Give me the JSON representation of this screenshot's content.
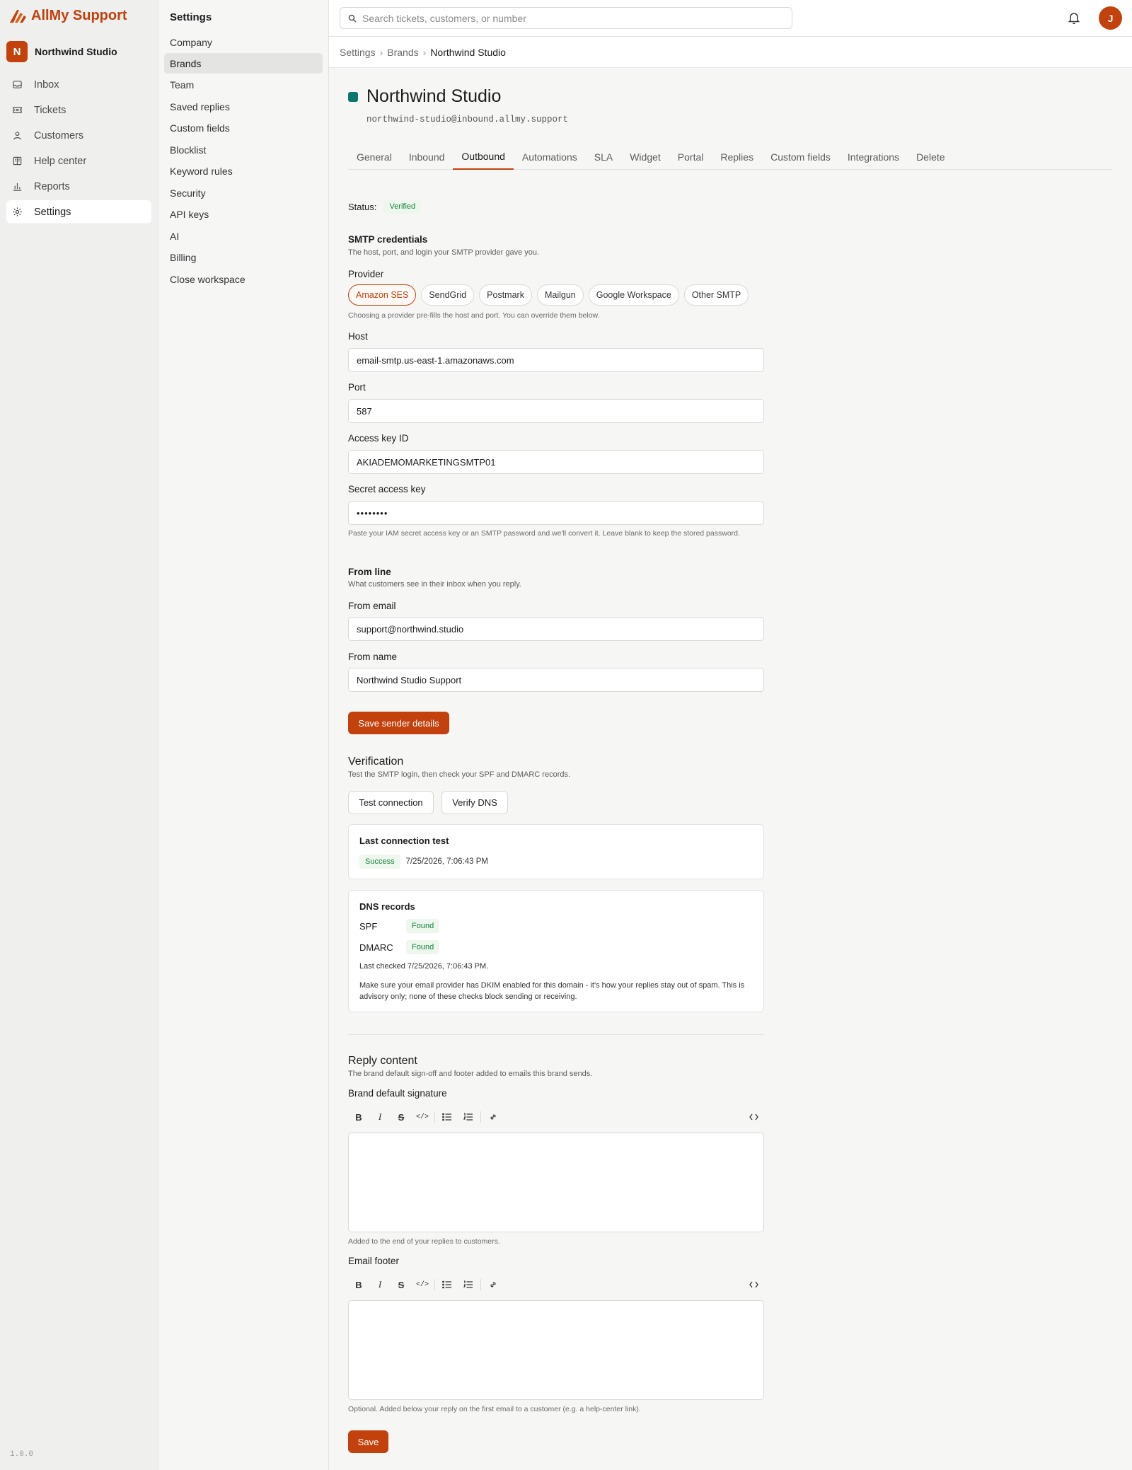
{
  "app": {
    "name": "AllMy Support",
    "version": "1.0.0",
    "accent": "#c2410c"
  },
  "workspace": {
    "initial": "N",
    "name": "Northwind Studio"
  },
  "nav": [
    {
      "label": "Inbox",
      "icon": "inbox-icon"
    },
    {
      "label": "Tickets",
      "icon": "ticket-icon"
    },
    {
      "label": "Customers",
      "icon": "user-icon"
    },
    {
      "label": "Help center",
      "icon": "book-icon"
    },
    {
      "label": "Reports",
      "icon": "bar-chart-icon"
    },
    {
      "label": "Settings",
      "icon": "gear-icon",
      "active": true
    }
  ],
  "settings_nav": {
    "title": "Settings",
    "items": [
      "Company",
      "Brands",
      "Team",
      "Saved replies",
      "Custom fields",
      "Blocklist",
      "Keyword rules",
      "Security",
      "API keys",
      "AI",
      "Billing",
      "Close workspace"
    ],
    "active": "Brands"
  },
  "search": {
    "placeholder": "Search tickets, customers, or number"
  },
  "user": {
    "initial": "J"
  },
  "breadcrumb": [
    "Settings",
    "Brands",
    "Northwind Studio"
  ],
  "brand": {
    "name": "Northwind Studio",
    "email": "northwind-studio@inbound.allmy.support",
    "color": "#0f766e"
  },
  "tabs": [
    "General",
    "Inbound",
    "Outbound",
    "Automations",
    "SLA",
    "Widget",
    "Portal",
    "Replies",
    "Custom fields",
    "Integrations",
    "Delete"
  ],
  "active_tab": "Outbound",
  "status": {
    "label": "Status:",
    "value": "Verified"
  },
  "smtp": {
    "title": "SMTP credentials",
    "subtitle": "The host, port, and login your SMTP provider gave you.",
    "provider_label": "Provider",
    "providers": [
      "Amazon SES",
      "SendGrid",
      "Postmark",
      "Mailgun",
      "Google Workspace",
      "Other SMTP"
    ],
    "active_provider": "Amazon SES",
    "provider_help": "Choosing a provider pre-fills the host and port. You can override them below.",
    "host_label": "Host",
    "host_value": "email-smtp.us-east-1.amazonaws.com",
    "port_label": "Port",
    "port_value": "587",
    "access_key_label": "Access key ID",
    "access_key_value": "AKIADEMOMARKETINGSMTP01",
    "secret_label": "Secret access key",
    "secret_value": "••••••••",
    "secret_help": "Paste your IAM secret access key or an SMTP password and we'll convert it. Leave blank to keep the stored password."
  },
  "from_line": {
    "title": "From line",
    "subtitle": "What customers see in their inbox when you reply.",
    "email_label": "From email",
    "email_value": "support@northwind.studio",
    "name_label": "From name",
    "name_value": "Northwind Studio Support",
    "save_button": "Save sender details"
  },
  "verification": {
    "title": "Verification",
    "subtitle": "Test the SMTP login, then check your SPF and DMARC records.",
    "test_button": "Test connection",
    "verify_button": "Verify DNS",
    "last_test": {
      "title": "Last connection test",
      "status": "Success",
      "time": "7/25/2026, 7:06:43 PM"
    },
    "dns": {
      "title": "DNS records",
      "records": [
        {
          "name": "SPF",
          "status": "Found"
        },
        {
          "name": "DMARC",
          "status": "Found"
        }
      ],
      "last_checked": "Last checked 7/25/2026, 7:06:43 PM.",
      "note": "Make sure your email provider has DKIM enabled for this domain - it's how your replies stay out of spam. This is advisory only; none of these checks block sending or receiving."
    }
  },
  "reply_content": {
    "title": "Reply content",
    "subtitle": "The brand default sign-off and footer added to emails this brand sends.",
    "signature_label": "Brand default signature",
    "signature_help": "Added to the end of your replies to customers.",
    "footer_label": "Email footer",
    "footer_help": "Optional. Added below your reply on the first email to a customer (e.g. a help-center link).",
    "save_button": "Save"
  }
}
